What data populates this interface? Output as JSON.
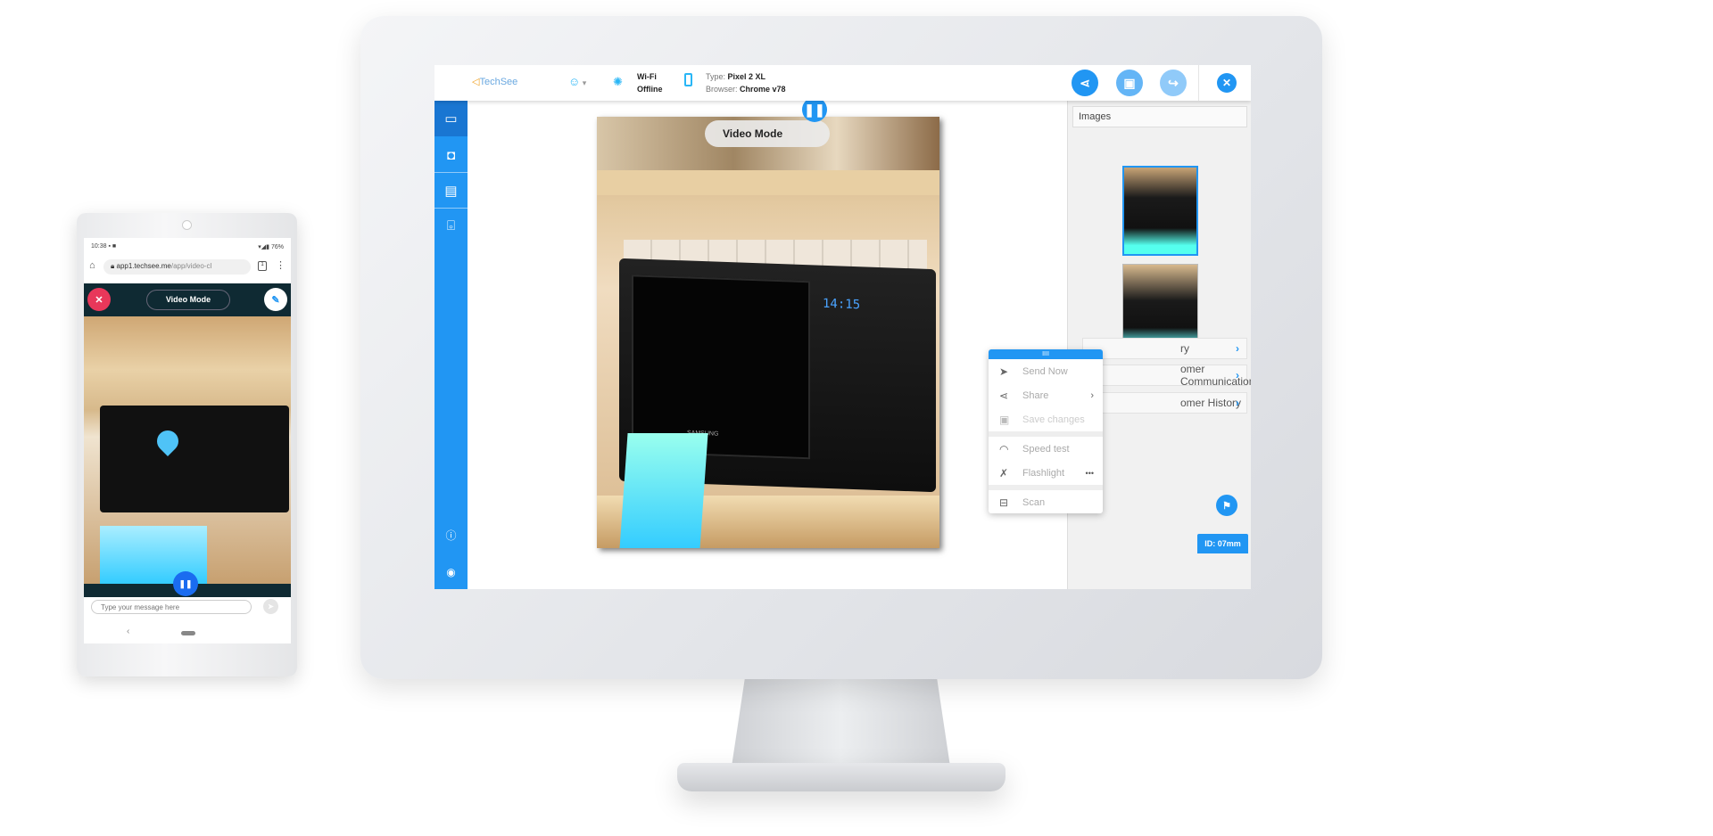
{
  "desktop": {
    "topbar": {
      "logo": "TechSee",
      "network_label": "Wi-Fi",
      "network_status": "Offline",
      "type_label": "Type:",
      "type_value": "Pixel 2 XL",
      "browser_label": "Browser:",
      "browser_value": "Chrome v78",
      "buttons": [
        "share-icon",
        "save-icon",
        "forward-icon",
        "close-icon"
      ]
    },
    "sidebar": {
      "icons": [
        "video-camera-icon",
        "camera-icon",
        "screens-icon",
        "scan-face-icon",
        "help-icon",
        "user-icon"
      ]
    },
    "video": {
      "mode_label": "Video Mode",
      "display_time": "14:15",
      "brand": "SAMSUNG"
    },
    "context_menu": {
      "items": [
        {
          "label": "Send Now",
          "icon": "send-icon"
        },
        {
          "label": "Share",
          "icon": "share-icon",
          "arrow": "›"
        },
        {
          "label": "Save changes",
          "icon": "save-icon"
        },
        {
          "label": "Speed test",
          "icon": "speedometer-icon"
        },
        {
          "label": "Flashlight",
          "icon": "flashlight-icon",
          "more": "•••"
        },
        {
          "label": "Scan",
          "icon": "scan-icon"
        }
      ]
    },
    "right_panel": {
      "images_header": "Images",
      "accordion": [
        {
          "label": "ry"
        },
        {
          "label": "omer Communications"
        },
        {
          "label": "omer History"
        }
      ],
      "session_id": "ID: 07mm"
    },
    "accent": "#2196f3"
  },
  "phone": {
    "status_time": "10:38",
    "battery": "76%",
    "url_host": "app1.techsee.me",
    "url_path": "/app/video-cl",
    "tab_count": "1",
    "mode_label": "Video Mode",
    "message_placeholder": "Type your message here"
  }
}
